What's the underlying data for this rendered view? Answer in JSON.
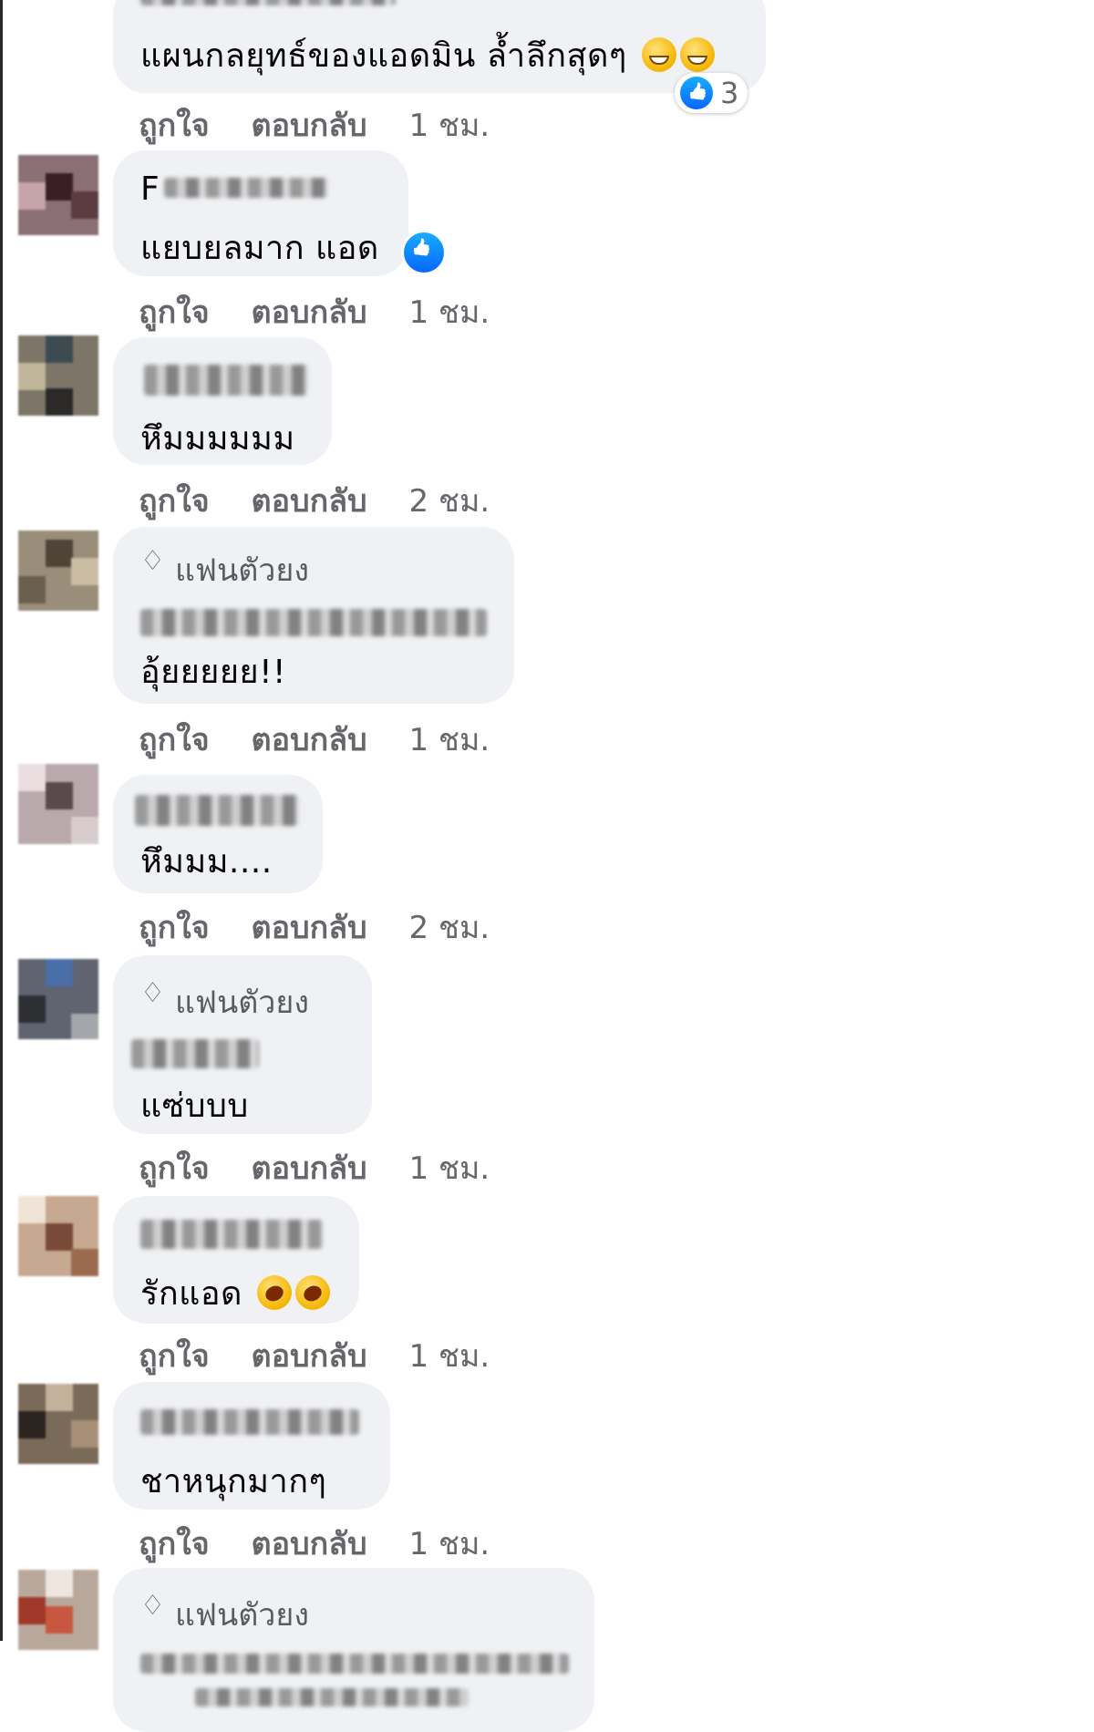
{
  "badge_label": "แฟนตัวยง",
  "actions": {
    "like": "ถูกใจ",
    "reply": "ตอบกลับ"
  },
  "comments": [
    {
      "name_prefix": "",
      "text": "แผนกลยุทธ์ของแอดมิน ล้ำลึกสุดๆ",
      "emoji": [
        "grin",
        "grin"
      ],
      "reaction_count": "3",
      "time": "1 ชม."
    },
    {
      "name_prefix": "F",
      "text": "แยบยลมาก แอด",
      "emoji": [],
      "time": "1 ชม."
    },
    {
      "name_prefix": "",
      "text": "หึมมมมมม",
      "emoji": [],
      "time": "2 ชม."
    },
    {
      "name_prefix": "",
      "text": "อุ้ยยยยย!!",
      "emoji": [],
      "time": "1 ชม."
    },
    {
      "name_prefix": "",
      "text": "หึมมม....",
      "emoji": [],
      "time": "2 ชม."
    },
    {
      "name_prefix": "",
      "text": "แซ่บบบ",
      "emoji": [],
      "time": "1 ชม."
    },
    {
      "name_prefix": "",
      "text": "รักแอด",
      "emoji": [
        "rofl",
        "rofl"
      ],
      "time": "1 ชม."
    },
    {
      "name_prefix": "",
      "text": "ชาหนุกมากๆ",
      "emoji": [],
      "time": "1 ชม."
    },
    {
      "name_prefix": "",
      "text": "",
      "emoji": [],
      "time": ""
    }
  ]
}
